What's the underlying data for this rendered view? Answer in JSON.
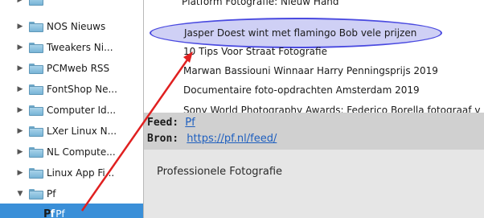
{
  "sidebar": {
    "items": [
      {
        "label": "NOS Nieuws",
        "expanded": false
      },
      {
        "label": "Tweakers Ni...",
        "expanded": false
      },
      {
        "label": "PCMweb RSS",
        "expanded": false
      },
      {
        "label": "FontShop Ne...",
        "expanded": false
      },
      {
        "label": "Computer Id...",
        "expanded": false
      },
      {
        "label": "LXer Linux N...",
        "expanded": false
      },
      {
        "label": "NL Compute...",
        "expanded": false
      },
      {
        "label": "Linux App Fi...",
        "expanded": false
      },
      {
        "label": "Pf",
        "expanded": true
      }
    ],
    "selected_feed": {
      "icon_text": "Pf",
      "label": "Pf"
    }
  },
  "articles": [
    "Jasper Doest wint met flamingo Bob vele prijzen",
    "10 Tips Voor Straat Fotografie",
    "Marwan Bassiouni Winnaar Harry Penningsprijs 2019",
    "Documentaire foto-opdrachten Amsterdam 2019"
  ],
  "details": {
    "feed_label": "Feed:",
    "feed_value": "Pf",
    "source_label": "Bron:",
    "source_value": "https://pf.nl/feed/",
    "description": "Professionele Fotografie"
  },
  "colors": {
    "selection": "#3a8fd8",
    "highlight_fill": "#cfd0f5",
    "highlight_stroke": "#4a4ae0",
    "annotation_arrow": "#e02020",
    "link": "#1e5fbf"
  }
}
